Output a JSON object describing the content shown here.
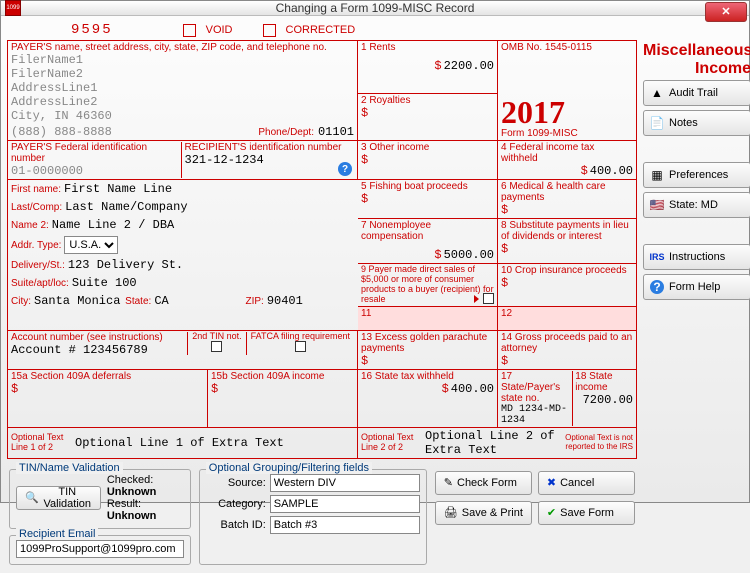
{
  "window": {
    "title": "Changing a Form 1099-MISC Record"
  },
  "header": {
    "code": "9595",
    "void_label": "VOID",
    "corrected_label": "CORRECTED"
  },
  "payer_block": {
    "label": "PAYER'S name, street address, city, state, ZIP code, and telephone no.",
    "filer1": "FilerName1",
    "filer2": "FilerName2",
    "addr1": "AddressLine1",
    "addr2": "AddressLine2",
    "citystate": "City, IN 46360",
    "phone": "(888) 888-8888",
    "phone_label": "Phone/Dept:",
    "dept": "01101"
  },
  "box1": {
    "label": "1  Rents",
    "value": "2200.00"
  },
  "box2": {
    "label": "2 Royalties",
    "value": ""
  },
  "omb": "OMB No. 1545-0115",
  "year": "2017",
  "formname": "Form 1099-MISC",
  "misc_title1": "Miscellaneous",
  "misc_title2": "Income",
  "box3": {
    "label": "3 Other income",
    "value": ""
  },
  "box4": {
    "label": "4 Federal income tax withheld",
    "value": "400.00"
  },
  "payer_fid": {
    "label": "PAYER'S Federal identification number",
    "value": "01-0000000"
  },
  "recip_id": {
    "label": "RECIPIENT'S identification number",
    "value": "321-12-1234"
  },
  "box5": {
    "label": "5 Fishing boat proceeds",
    "value": ""
  },
  "box6": {
    "label": "6 Medical & health care payments",
    "value": ""
  },
  "recip": {
    "first_label": "First name:",
    "first": "First Name Line",
    "last_label": "Last/Comp:",
    "last": "Last Name/Company",
    "name2_label": "Name 2:",
    "name2": "Name Line 2 / DBA",
    "addr_type_label": "Addr. Type:",
    "addr_type": "U.S.A.",
    "delivery_label": "Delivery/St.:",
    "delivery": "123 Delivery St.",
    "suite_label": "Suite/apt/loc:",
    "suite": "Suite 100",
    "city_label": "City:",
    "city": "Santa Monica",
    "state_label": "State:",
    "state": "CA",
    "zip_label": "ZIP:",
    "zip": "90401"
  },
  "box7": {
    "label": "7 Nonemployee compensation",
    "value": "5000.00"
  },
  "box8": {
    "label": "8 Substitute payments in lieu of dividends or interest",
    "value": ""
  },
  "box9": {
    "label": "9  Payer made direct sales of $5,000 or more of consumer products to a buyer (recipient) for resale",
    "value": ""
  },
  "box10": {
    "label": "10 Crop insurance proceeds",
    "value": ""
  },
  "box11": {
    "label": "11"
  },
  "box12": {
    "label": "12"
  },
  "acct": {
    "label": "Account number (see instructions)",
    "value": "Account # 123456789"
  },
  "tin2": {
    "label": "2nd TIN not."
  },
  "fatca": {
    "label": "FATCA filing requirement"
  },
  "box13": {
    "label": "13 Excess golden parachute payments",
    "value": ""
  },
  "box14": {
    "label": "14 Gross proceeds paid to an attorney",
    "value": ""
  },
  "box15a": {
    "label": "15a Section 409A deferrals",
    "value": ""
  },
  "box15b": {
    "label": "15b Section 409A income",
    "value": ""
  },
  "box16": {
    "label": "16 State tax withheld",
    "value": "400.00"
  },
  "box17": {
    "label": "17 State/Payer's state no.",
    "value": "MD 1234-MD-1234"
  },
  "box18": {
    "label": "18  State income",
    "value": "7200.00"
  },
  "opt1": {
    "label": "Optional Text Line 1 of 2",
    "value": "Optional Line 1 of Extra Text"
  },
  "opt2": {
    "label": "Optional Text Line 2 of 2",
    "value": "Optional Line 2 of Extra Text"
  },
  "opt3": {
    "label": "Optional Text is not reported to the IRS"
  },
  "tin_validation": {
    "legend": "TIN/Name Validation",
    "btn": "TIN Validation",
    "checked_label": "Checked:",
    "checked": "Unknown",
    "result_label": "Result:",
    "result": "Unknown"
  },
  "recip_email": {
    "legend": "Recipient Email",
    "value": "1099ProSupport@1099pro.com"
  },
  "optgroup": {
    "legend": "Optional Grouping/Filtering fields",
    "source_label": "Source:",
    "source": "Western DIV",
    "category_label": "Category:",
    "category": "SAMPLE",
    "batch_label": "Batch ID:",
    "batch": "Batch #3"
  },
  "side": {
    "audit": "Audit Trail",
    "notes": "Notes",
    "prefs": "Preferences",
    "state": "State: MD",
    "instr": "Instructions",
    "help": "Form Help"
  },
  "footer": {
    "check": "Check Form",
    "cancel": "Cancel",
    "saveprint": "Save & Print",
    "save": "Save Form"
  }
}
